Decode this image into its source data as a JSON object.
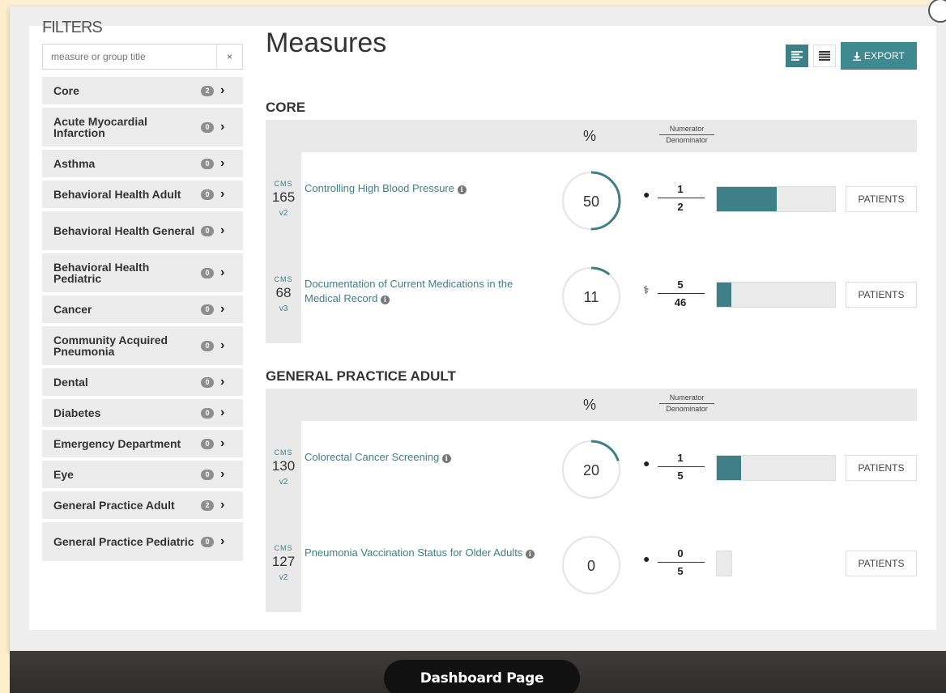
{
  "filters": {
    "title": "FILTERS",
    "search_placeholder": "measure or group title",
    "clear_label": "×",
    "items": [
      {
        "label": "Core",
        "count": "2"
      },
      {
        "label": "Acute Myocardial Infarction",
        "count": "0"
      },
      {
        "label": "Asthma",
        "count": "0"
      },
      {
        "label": "Behavioral Health Adult",
        "count": "0"
      },
      {
        "label": "Behavioral Health General",
        "count": "0"
      },
      {
        "label": "Behavioral Health Pediatric",
        "count": "0"
      },
      {
        "label": "Cancer",
        "count": "0"
      },
      {
        "label": "Community Acquired Pneumonia",
        "count": "0"
      },
      {
        "label": "Dental",
        "count": "0"
      },
      {
        "label": "Diabetes",
        "count": "0"
      },
      {
        "label": "Emergency Department",
        "count": "0"
      },
      {
        "label": "Eye",
        "count": "0"
      },
      {
        "label": "General Practice Adult",
        "count": "2"
      },
      {
        "label": "General Practice Pediatric",
        "count": "0"
      }
    ]
  },
  "main": {
    "title": "Measures",
    "export_label": "EXPORT",
    "pct_header": "%",
    "numerator_header": "Numerator",
    "denominator_header": "Denominator",
    "patients_label": "PATIENTS",
    "cms_label": "CMS",
    "sections": [
      {
        "title": "CORE",
        "measures": [
          {
            "cms": "165",
            "version": "v2",
            "name": "Controlling High Blood Pressure",
            "percent": 50,
            "numerator": "1",
            "denominator": "2",
            "icon": "person-icon",
            "bar_fill": 0.5
          },
          {
            "cms": "68",
            "version": "v3",
            "name": "Documentation of Current Medications in the Medical Record",
            "percent": 11,
            "numerator": "5",
            "denominator": "46",
            "icon": "stethoscope-icon",
            "bar_fill": 0.11
          }
        ]
      },
      {
        "title": "GENERAL PRACTICE ADULT",
        "measures": [
          {
            "cms": "130",
            "version": "v2",
            "name": "Colorectal Cancer Screening",
            "percent": 20,
            "numerator": "1",
            "denominator": "5",
            "icon": "person-icon",
            "bar_fill": 0.2
          },
          {
            "cms": "127",
            "version": "v2",
            "name": "Pneumonia Vaccination Status for Older Adults",
            "percent": 0,
            "numerator": "0",
            "denominator": "5",
            "icon": "person-icon",
            "bar_fill": 0
          }
        ]
      }
    ]
  },
  "footer": {
    "dashboard_label": "Dashboard Page"
  },
  "colors": {
    "accent": "#3f7f86",
    "gauge_track": "#e4e4e4"
  }
}
